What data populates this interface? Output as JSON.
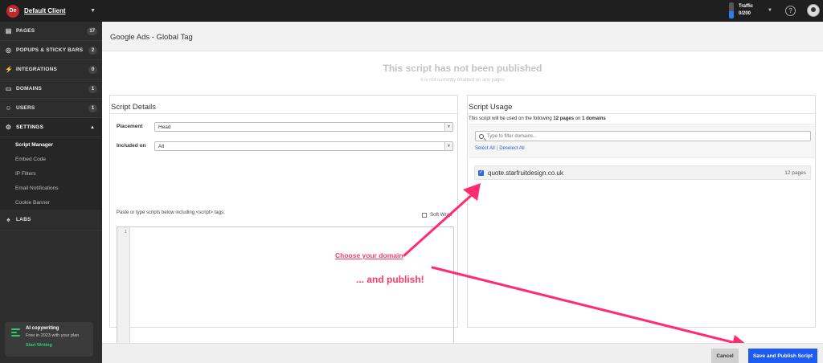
{
  "client": {
    "badge": "De",
    "name": "Default Client"
  },
  "sidebar": {
    "items": [
      {
        "label": "PAGES",
        "count": "17",
        "icon": "pages-icon"
      },
      {
        "label": "POPUPS & STICKY BARS",
        "count": "2",
        "icon": "popups-icon"
      },
      {
        "label": "INTEGRATIONS",
        "count": "0",
        "icon": "plug-icon"
      },
      {
        "label": "DOMAINS",
        "count": "1",
        "icon": "domain-icon"
      },
      {
        "label": "USERS",
        "count": "1",
        "icon": "users-icon"
      },
      {
        "label": "SETTINGS",
        "icon": "gear-icon"
      }
    ],
    "settings_sub": [
      "Script Manager",
      "Embed Code",
      "IP Filters",
      "Email Notifications",
      "Cookie Banner"
    ],
    "labs": "LABS",
    "ai": {
      "title": "AI copywriting",
      "subtitle": "Free in 2023 with your plan",
      "link": "Start Writing"
    }
  },
  "topbar": {
    "traffic_label": "Traffic",
    "traffic_value": "0/200",
    "traffic_fill": 0.45
  },
  "page_title": "Google Ads - Global Tag",
  "notice": {
    "heading": "This script has not been published",
    "sub": "It is not currently enabled on any pages"
  },
  "details": {
    "title": "Script Details",
    "placement_label": "Placement",
    "placement_value": "Head",
    "included_label": "Included on",
    "included_value": "All",
    "hint": "Paste or type scripts below including <script> tags.",
    "soft_wrap": "Soft Wrap",
    "line_no": "1"
  },
  "usage": {
    "title": "Script Usage",
    "desc_pre": "This script will be used on the following ",
    "desc_pages": "12 pages",
    "desc_mid": " on ",
    "desc_domains": "1 domains",
    "filter_placeholder": "Type to filter domains...",
    "select_all": "Select All",
    "deselect_all": "Deselect All",
    "domain": "quote.starfruitdesign.co.uk",
    "domain_pages": "12 pages"
  },
  "annotations": {
    "choose": "Choose your domain",
    "publish": "... and publish!"
  },
  "footer": {
    "cancel": "Cancel",
    "save": "Save and Publish Script"
  }
}
